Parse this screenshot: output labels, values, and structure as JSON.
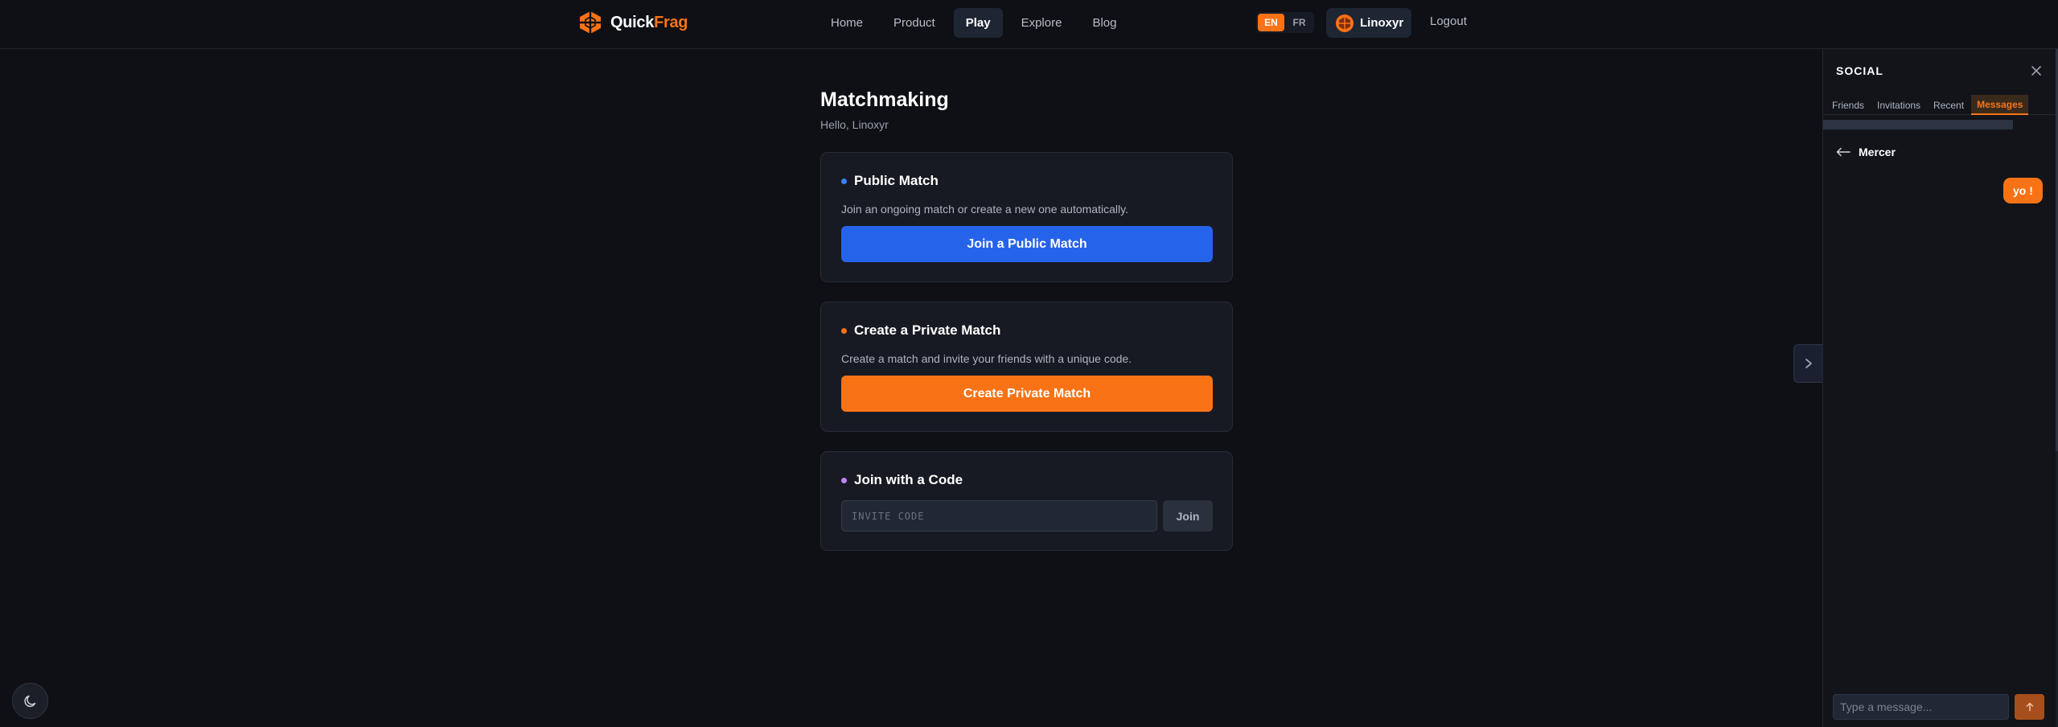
{
  "brand": {
    "name_part1": "Quick",
    "name_part2": "Frag",
    "accent": "#f97316"
  },
  "nav": {
    "items": [
      {
        "label": "Home"
      },
      {
        "label": "Product"
      },
      {
        "label": "Play",
        "active": true
      },
      {
        "label": "Explore"
      },
      {
        "label": "Blog"
      }
    ]
  },
  "lang": {
    "en": "EN",
    "fr": "FR",
    "active": "EN"
  },
  "user": {
    "name": "Linoxyr",
    "logout_label": "Logout"
  },
  "main": {
    "title": "Matchmaking",
    "greeting": "Hello, Linoxyr",
    "public": {
      "title": "Public Match",
      "description": "Join an ongoing match or create a new one automatically.",
      "button": "Join a Public Match",
      "dot_color": "#3b82f6"
    },
    "private": {
      "title": "Create a Private Match",
      "description": "Create a match and invite your friends with a unique code.",
      "button": "Create Private Match",
      "dot_color": "#f97316"
    },
    "code": {
      "title": "Join with a Code",
      "placeholder": "INVITE CODE",
      "button": "Join",
      "dot_color": "#c084fc"
    }
  },
  "social": {
    "title": "SOCIAL",
    "tabs": [
      {
        "label": "Friends"
      },
      {
        "label": "Invitations"
      },
      {
        "label": "Recent"
      },
      {
        "label": "Messages",
        "active": true
      }
    ],
    "chat": {
      "contact": "Mercer",
      "messages": [
        {
          "text": "yo !",
          "outgoing": true
        }
      ],
      "input_placeholder": "Type a message..."
    }
  }
}
